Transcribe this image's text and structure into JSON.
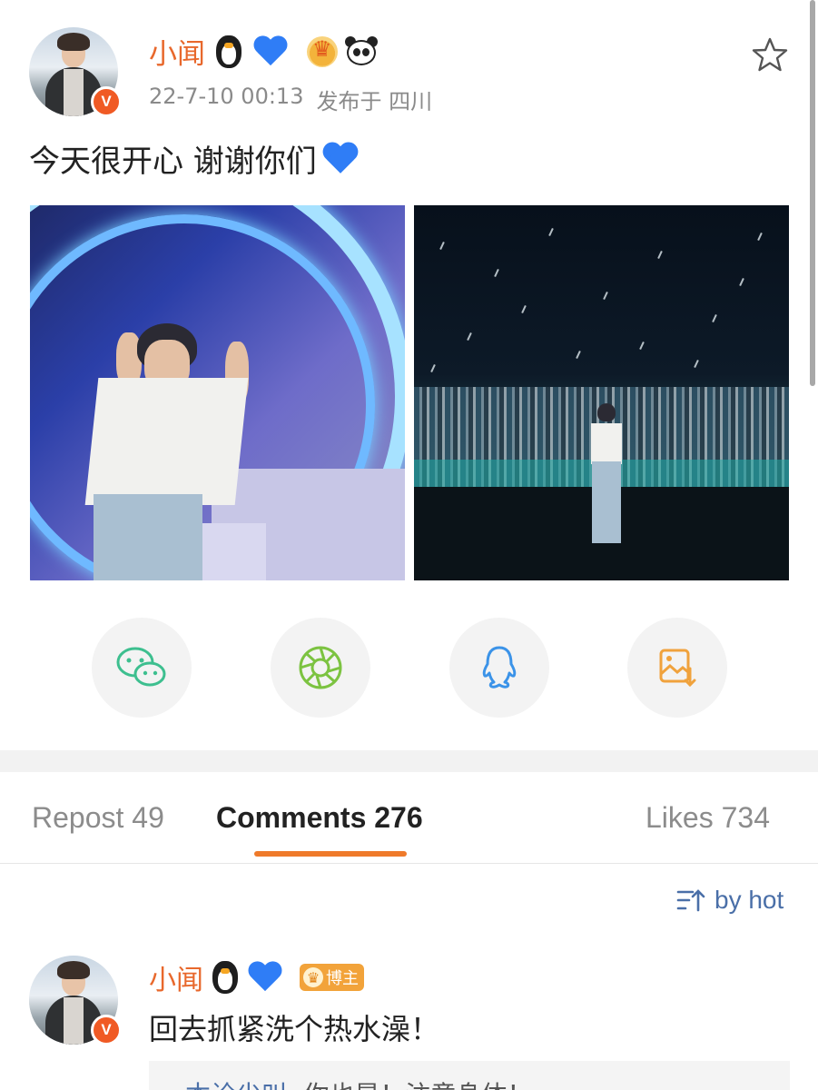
{
  "post": {
    "username": "小闻",
    "verified_badge": "V",
    "badges": [
      "penguin-icon",
      "blue-heart-icon",
      "crown-icon",
      "panda-icon"
    ],
    "time": "22-7-10 00:13",
    "location": "发布于 四川",
    "text": "今天很开心 谢谢你们",
    "text_emoji": "blue-heart-icon"
  },
  "share": {
    "items": [
      "wechat-icon",
      "moments-icon",
      "qq-icon",
      "save-image-icon"
    ]
  },
  "tabs": {
    "repost": "Repost 49",
    "comments": "Comments 276",
    "likes": "Likes 734"
  },
  "sort": {
    "label": "by hot"
  },
  "comment": {
    "username": "小闻",
    "tag": "博主",
    "text": "回去抓紧洗个热水澡！",
    "reply_user": "本诠尖叫",
    "reply_text": "你也是！注意身体！"
  },
  "colors": {
    "username": "#e8682c",
    "accent_underline": "#ef7a2a",
    "link": "#4a6fa8"
  }
}
